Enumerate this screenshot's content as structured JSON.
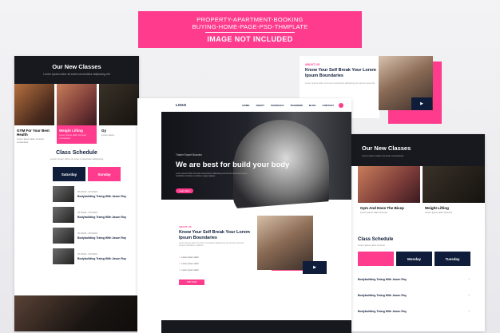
{
  "banner": {
    "line1": "PROPERTY-APARTMENT-BOOKING",
    "line2": "BUYING-HOME-PAGE-PSD-THMPLATE",
    "line3": "IMAGE NOT INCLUDED"
  },
  "left_page": {
    "classes_title": "Our New Classes",
    "classes_sub": "Lorem ipsum dolor sit amet consectetur adipiscing elit",
    "cards": [
      {
        "title": "GYM For Your Best Health",
        "text": "Lorem ipsum dolor sit amet consectetur"
      },
      {
        "title": "Weight Lifting",
        "text": "Lorem ipsum dolor sit amet consectetur"
      },
      {
        "title": "Gy",
        "text": "Lorem ipsum"
      }
    ],
    "schedule_title": "Class Schedule",
    "schedule_sub": "Lorem ipsum dolor sit amet consectetur adipiscing",
    "days": [
      "Saturday",
      "Sunday"
    ],
    "rows": [
      {
        "time": "06:00AM - 08:00AM",
        "name": "Bodybuilding Traing With Jason Roy"
      },
      {
        "time": "06:00AM - 08:00AM",
        "name": "Bodybuilding Traing With Jason Roy"
      },
      {
        "time": "06:00AM - 08:00AM",
        "name": "Bodybuilding Traing With Jason Roy"
      },
      {
        "time": "06:00AM - 08:00AM",
        "name": "Bodybuilding Traing With Jason Roy"
      }
    ]
  },
  "right_top": {
    "tag": "ABOUT US",
    "heading": "Know Your Self Break Your Lorem Ipsum Boundaries",
    "text": "Lorem ipsum dolor sit amet consectetur adipiscing elit sed do eiusmod"
  },
  "center_page": {
    "logo": "LOGO",
    "menu": [
      "HOME",
      "ABOUT",
      "SCHEDULE",
      "TRAINERS",
      "BLOG",
      "CONTACT"
    ],
    "hero_sub": "Trainer Expert Boardon",
    "hero_title": "We are best for build your body",
    "hero_desc": "Lorem ipsum dolor sit amet consectetur adipiscing elit sed do eiusmod tempor incididunt ut labore et dolore magna aliqua",
    "hero_button": "Learn More",
    "about_tag": "ABOUT US",
    "about_heading": "Know Your Self Break Your Lorem Ipsum Boundaries",
    "about_text": "Lorem ipsum dolor sit amet consectetur adipiscing elit sed do eiusmod tempor incididunt ut labore",
    "about_list": [
      "Lorem ipsum dolor",
      "Lorem ipsum dolor",
      "Lorem ipsum dolor"
    ],
    "about_button": "JOIN NOW"
  },
  "right_page": {
    "classes_title": "Our New Classes",
    "classes_sub": "Lorem ipsum dolor sit amet consectetur",
    "cards": [
      {
        "title": "Gym And Does The Bicep",
        "text": "Lorem ipsum dolor sit amet"
      },
      {
        "title": "Weight Lifting",
        "text": "Lorem ipsum dolor sit amet"
      }
    ],
    "schedule_title": "Class Schedule",
    "schedule_sub": "Lorem ipsum dolor sit amet",
    "days": [
      "Monday",
      "Tuesday"
    ],
    "rows": [
      {
        "name": "Bodybuilding Traing With Jason Roy"
      },
      {
        "name": "Bodybuilding Traing With Jason Roy"
      },
      {
        "name": "Bodybuilding Traing With Jason Roy"
      }
    ]
  },
  "icons": {
    "play": "play-icon",
    "check": "check-icon",
    "chevron": "chevron-right-icon"
  },
  "colors": {
    "accent": "#ff3b8e",
    "navy": "#0f1d3a",
    "dark": "#17191f"
  }
}
